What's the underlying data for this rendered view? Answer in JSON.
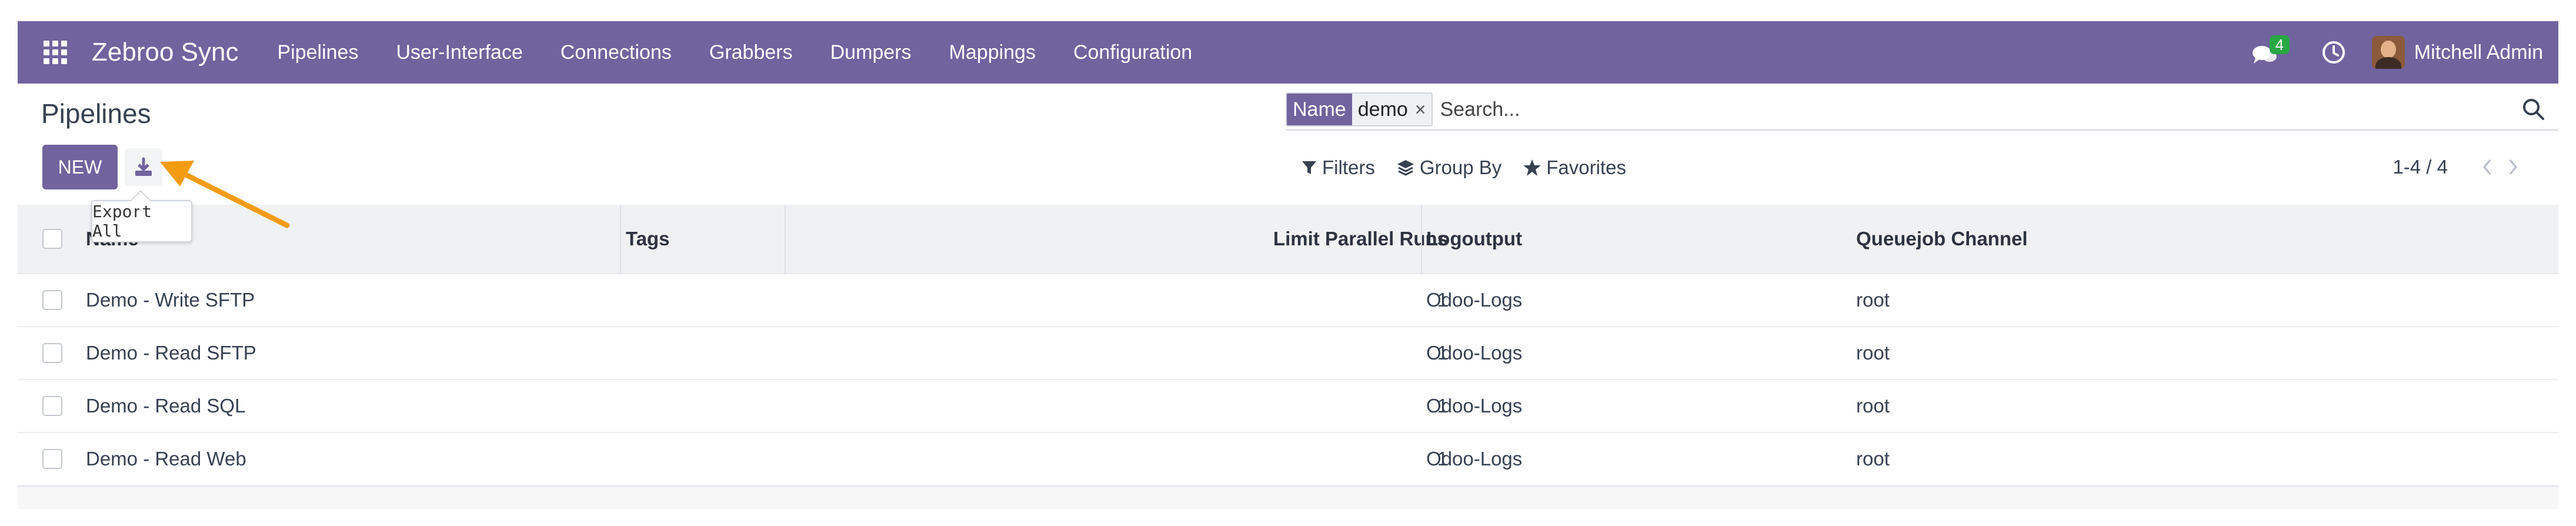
{
  "navbar": {
    "brand": "Zebroo Sync",
    "menu": [
      "Pipelines",
      "User-Interface",
      "Connections",
      "Grabbers",
      "Dumpers",
      "Mappings",
      "Configuration"
    ],
    "chat_count": "4",
    "user_name": "Mitchell Admin"
  },
  "page": {
    "title": "Pipelines"
  },
  "search": {
    "facet_label": "Name",
    "facet_value": "demo",
    "facet_remove": "×",
    "placeholder": "Search..."
  },
  "buttons": {
    "new_label": "NEW",
    "export_tooltip": "Export All"
  },
  "toolbar": {
    "filters": "Filters",
    "group_by": "Group By",
    "favorites": "Favorites"
  },
  "pager": {
    "value": "1-4 / 4"
  },
  "list": {
    "columns": {
      "name": "Name",
      "tags": "Tags",
      "limit": "Limit Parallel Runs",
      "logoutput": "Logoutput",
      "queue": "Queuejob Channel"
    },
    "rows": [
      {
        "name": "Demo - Write SFTP",
        "tags": "",
        "limit": "1",
        "logoutput": "Odoo-Logs",
        "queue": "root"
      },
      {
        "name": "Demo - Read SFTP",
        "tags": "",
        "limit": "1",
        "logoutput": "Odoo-Logs",
        "queue": "root"
      },
      {
        "name": "Demo - Read SQL",
        "tags": "",
        "limit": "1",
        "logoutput": "Odoo-Logs",
        "queue": "root"
      },
      {
        "name": "Demo - Read Web",
        "tags": "",
        "limit": "1",
        "logoutput": "Odoo-Logs",
        "queue": "root"
      }
    ]
  },
  "colors": {
    "brand": "#71639e",
    "badge": "#28a745",
    "annotation_arrow": "#f39c12"
  },
  "icons": {
    "apps": "apps-grid-icon",
    "chat": "chat-bubbles-icon",
    "clock": "clock-icon",
    "search": "search-icon",
    "export": "download-icon",
    "filter": "funnel-icon",
    "group": "layers-icon",
    "favorite": "star-icon"
  }
}
